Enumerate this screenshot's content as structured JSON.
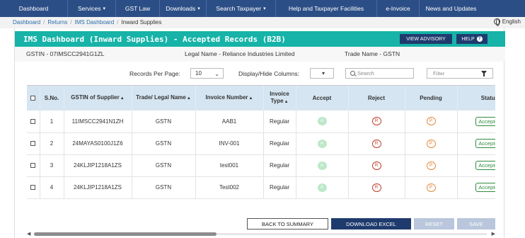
{
  "nav": {
    "items": [
      {
        "label": "Dashboard",
        "caret": false
      },
      {
        "label": "Services",
        "caret": true
      },
      {
        "label": "GST Law",
        "caret": false
      },
      {
        "label": "Downloads",
        "caret": true
      },
      {
        "label": "Search Taxpayer",
        "caret": true
      },
      {
        "label": "Help and Taxpayer Facilities",
        "caret": false
      },
      {
        "label": "e-Invoice",
        "caret": false
      },
      {
        "label": "News and Updates",
        "caret": false
      }
    ]
  },
  "breadcrumb": [
    "Dashboard",
    "Returns",
    "IMS Dashboard",
    "Inward Supplies"
  ],
  "language": "English",
  "card": {
    "title": "IMS Dashboard (Inward Supplies) - Accepted Records (B2B)",
    "view_advisory": "VIEW ADVISORY",
    "help": "HELP"
  },
  "info": {
    "gstin": "GSTIN - 07IMSCC2941G1ZL",
    "legal_name": "Legal Name - Reliance Industries Limited",
    "trade_name": "Trade Name - GSTN"
  },
  "controls": {
    "records_per_page_label": "Records Per Page:",
    "records_per_page_value": "10",
    "display_hide_label": "Display/Hide Columns:",
    "search_placeholder": "Search",
    "filter_placeholder": "Filter"
  },
  "table": {
    "headers": {
      "sno": "S.No.",
      "gstin": "GSTIN of Supplier",
      "trade": "Trade/ Legal Name",
      "invoice": "Invoice Number",
      "type": "Invoice Type",
      "accept": "Accept",
      "reject": "Reject",
      "pending": "Pending",
      "status": "Status"
    },
    "rows": [
      {
        "sno": "1",
        "gstin": "11IMSCC2941N1ZH",
        "trade": "GSTN",
        "invoice": "AAB1",
        "type": "Regular",
        "accept": "A",
        "reject": "R",
        "pending": "P",
        "status": "Accepted"
      },
      {
        "sno": "2",
        "gstin": "24MAYAS0100J1Z6",
        "trade": "GSTN",
        "invoice": "INV-001",
        "type": "Regular",
        "accept": "A",
        "reject": "R",
        "pending": "P",
        "status": "Accepted"
      },
      {
        "sno": "3",
        "gstin": "24KLJIP1218A1ZS",
        "trade": "GSTN",
        "invoice": "test001",
        "type": "Regular",
        "accept": "A",
        "reject": "R",
        "pending": "P",
        "status": "Accepted"
      },
      {
        "sno": "4",
        "gstin": "24KLJIP1218A1ZS",
        "trade": "GSTN",
        "invoice": "Test002",
        "type": "Regular",
        "accept": "A",
        "reject": "R",
        "pending": "P",
        "status": "Accepted"
      }
    ]
  },
  "footer": {
    "back": "BACK TO SUMMARY",
    "download": "DOWNLOAD EXCEL",
    "reset": "RESET",
    "save": "SAVE"
  },
  "colors": {
    "nav_bg": "#2c4e86",
    "header_teal": "#17b3a8",
    "primary_btn": "#1f3b6e",
    "table_header": "#d5e5f1"
  }
}
